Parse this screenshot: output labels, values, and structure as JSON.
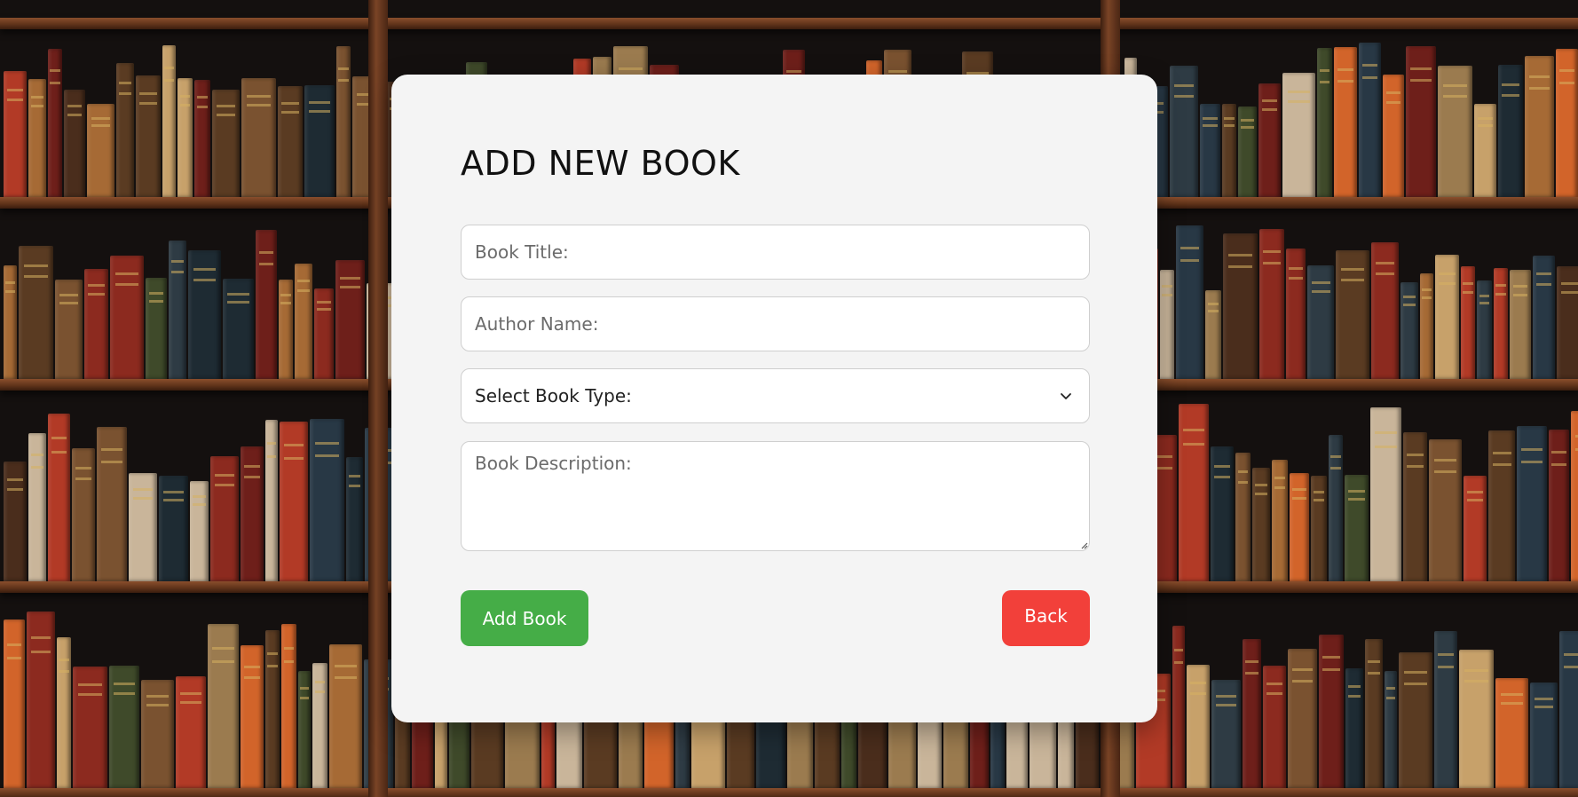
{
  "form": {
    "title": "ADD NEW BOOK",
    "book_title_placeholder": "Book Title:",
    "author_placeholder": "Author Name:",
    "book_type_selected": "Select Book Type:",
    "description_placeholder": "Book Description:",
    "add_label": "Add Book",
    "back_label": "Back"
  },
  "colors": {
    "card_bg": "#f4f4f4",
    "add_button": "#45ad47",
    "back_button": "#f2403a"
  },
  "icons": {
    "select_arrow": "chevron-down-icon"
  }
}
